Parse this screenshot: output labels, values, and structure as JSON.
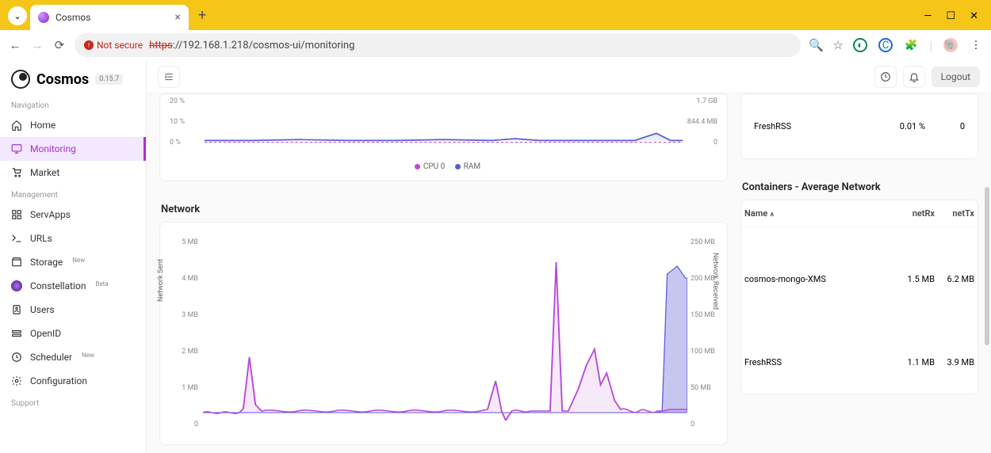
{
  "browser": {
    "tab_title": "Cosmos",
    "not_secure": "Not secure",
    "url_scheme": "https",
    "url_rest": "://192.168.1.218/cosmos-ui/monitoring"
  },
  "brand": {
    "name": "Cosmos",
    "version": "0.15.7"
  },
  "nav": {
    "section1": "Navigation",
    "home": "Home",
    "monitoring": "Monitoring",
    "market": "Market",
    "section2": "Management",
    "servapps": "ServApps",
    "urls": "URLs",
    "storage": "Storage",
    "storage_badge": "New",
    "constellation": "Constellation",
    "constellation_badge": "Beta",
    "users": "Users",
    "openid": "OpenID",
    "scheduler": "Scheduler",
    "scheduler_badge": "New",
    "configuration": "Configuration",
    "section3": "Support"
  },
  "topbar": {
    "logout": "Logout"
  },
  "cpu_chart": {
    "yl": [
      "20 %",
      "10 %",
      "0 %"
    ],
    "yr": [
      "1.7 GB",
      "844.4 MB",
      "0"
    ],
    "legend_cpu": "CPU 0",
    "legend_ram": "RAM"
  },
  "side_top": {
    "rows": [
      {
        "name": "FreshRSS",
        "v1": "0.01 %",
        "v2": "0"
      }
    ]
  },
  "network": {
    "title": "Network",
    "yl": [
      "5 MB",
      "4 MB",
      "3 MB",
      "2 MB",
      "1 MB",
      "0"
    ],
    "yr": [
      "250 MB",
      "200 MB",
      "150 MB",
      "100 MB",
      "50 MB",
      "0"
    ],
    "axis_l": "Network Sent",
    "axis_r": "Network Received"
  },
  "containers_net": {
    "title": "Containers - Average Network",
    "col1": "Name",
    "col2": "netRx",
    "col3": "netTx",
    "rows": [
      {
        "name": "cosmos-mongo-XMS",
        "rx": "1.5 MB",
        "tx": "6.2 MB"
      },
      {
        "name": "FreshRSS",
        "rx": "1.1 MB",
        "tx": "3.9 MB"
      }
    ]
  },
  "chart_data": [
    {
      "type": "line",
      "title": "CPU / RAM",
      "series": [
        {
          "name": "CPU 0",
          "axis": "left",
          "approx_values_pct": [
            4,
            4,
            4,
            4,
            4,
            4,
            4,
            5,
            4,
            4,
            4,
            5,
            4,
            4,
            4,
            4,
            4,
            4,
            4,
            4,
            5,
            4,
            4,
            4,
            4,
            4,
            4,
            4,
            4,
            5,
            4,
            4,
            9,
            4
          ]
        },
        {
          "name": "RAM",
          "axis": "right",
          "approx_values_mb": [
            420,
            420,
            420,
            420,
            420,
            420,
            420,
            420,
            420,
            420,
            420,
            420,
            420,
            420,
            420,
            420,
            420,
            420,
            420,
            420,
            420,
            420,
            420,
            420,
            420,
            420,
            420,
            420,
            420,
            422,
            420,
            420,
            470,
            420
          ]
        }
      ],
      "y_left": {
        "label": "%",
        "ticks": [
          0,
          10,
          20
        ]
      },
      "y_right": {
        "label": "MB",
        "ticks": [
          0,
          844.4,
          1700
        ]
      }
    },
    {
      "type": "area",
      "title": "Network",
      "series": [
        {
          "name": "Network Sent",
          "axis": "left",
          "unit": "MB",
          "approx_values": [
            0,
            0,
            0.1,
            1.4,
            0.2,
            0.05,
            0.05,
            0.05,
            0.05,
            0.05,
            0.05,
            0.05,
            0.05,
            0.05,
            0.8,
            0.1,
            -0.2,
            0.05,
            0.05,
            4.2,
            0.1,
            0.05,
            1.0,
            1.8,
            0.9,
            0.3,
            0.05,
            0.05,
            0.05,
            0.05,
            0.05,
            3.8,
            4.0,
            3.8
          ]
        },
        {
          "name": "Network Received",
          "axis": "right",
          "unit": "MB",
          "approx_values": [
            0,
            0,
            2,
            10,
            2,
            1,
            1,
            1,
            1,
            1,
            1,
            1,
            1,
            1,
            6,
            1,
            1,
            1,
            1,
            40,
            1,
            1,
            8,
            20,
            10,
            3,
            1,
            1,
            1,
            1,
            1,
            180,
            200,
            190
          ]
        }
      ],
      "y_left": {
        "label": "Network Sent",
        "ticks": [
          0,
          1,
          2,
          3,
          4,
          5
        ]
      },
      "y_right": {
        "label": "Network Received",
        "ticks": [
          0,
          50,
          100,
          150,
          200,
          250
        ]
      }
    }
  ]
}
